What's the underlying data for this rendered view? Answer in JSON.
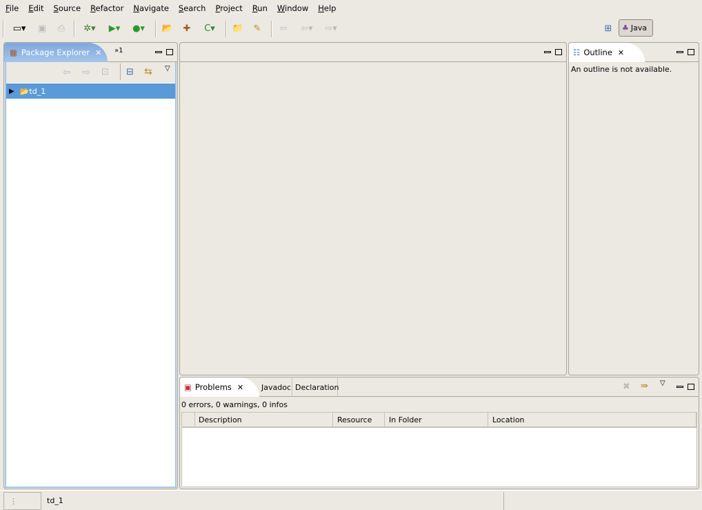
{
  "menu": [
    "File",
    "Edit",
    "Source",
    "Refactor",
    "Navigate",
    "Search",
    "Project",
    "Run",
    "Window",
    "Help"
  ],
  "toolbar": {
    "perspective_label": "Java"
  },
  "package_explorer": {
    "title": "Package Explorer",
    "overflow_label": "»1",
    "tree": [
      {
        "label": "td_1",
        "selected": true
      }
    ]
  },
  "outline": {
    "title": "Outline",
    "message": "An outline is not available."
  },
  "bottom": {
    "tabs": [
      "Problems",
      "Javadoc",
      "Declaration"
    ],
    "summary": "0 errors, 0 warnings, 0 infos",
    "columns": [
      "Description",
      "Resource",
      "In Folder",
      "Location"
    ]
  },
  "status": {
    "text": "td_1"
  },
  "colors": {
    "selection": "#5a9ad8",
    "tab_active": "#7fa9dd",
    "background": "#ece9e2"
  }
}
